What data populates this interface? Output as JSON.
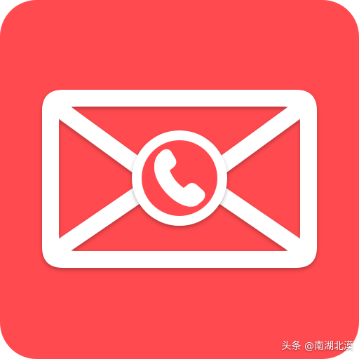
{
  "icon": {
    "name": "mail-phone-app-icon",
    "background_color": "#FF4A4F",
    "foreground_color": "#FFFFFF",
    "symbols": [
      "envelope-icon",
      "phone-handset-icon"
    ]
  },
  "watermark": {
    "text": "头条 @南湖北漠"
  }
}
